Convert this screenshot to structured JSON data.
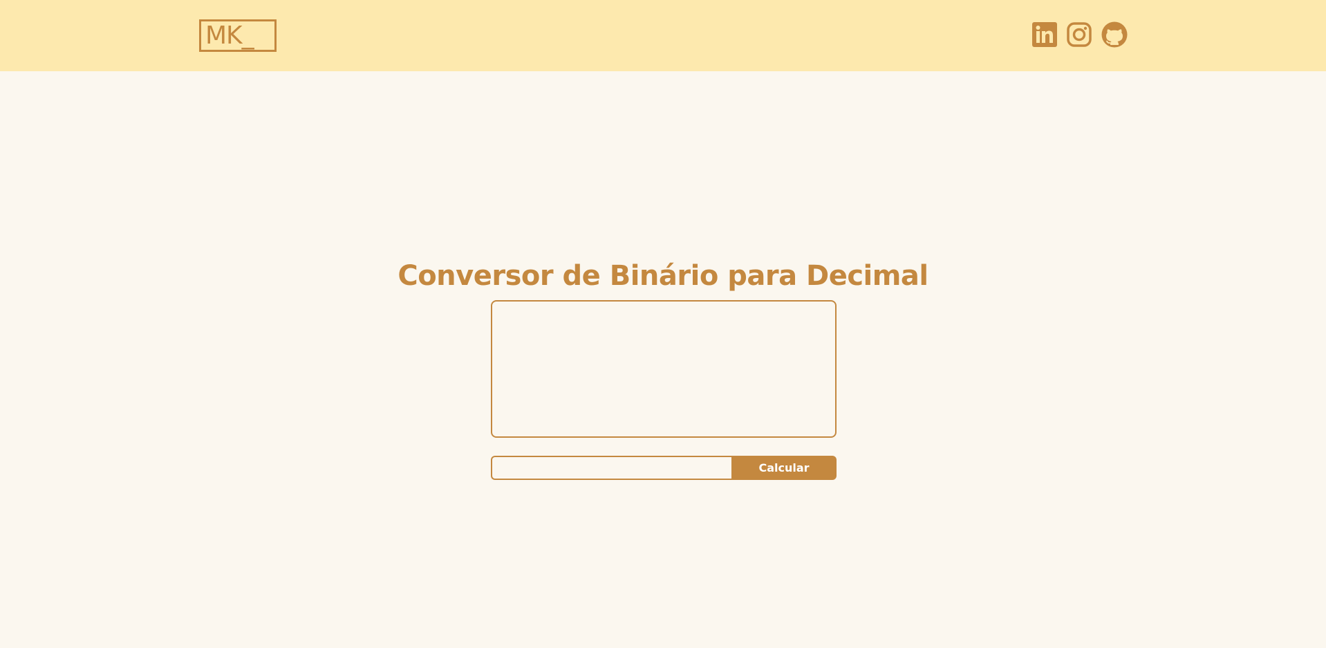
{
  "header": {
    "logo_text": "MK_",
    "social_links": [
      {
        "name": "LinkedIn",
        "icon": "linkedin-icon"
      },
      {
        "name": "Instagram",
        "icon": "instagram-icon"
      },
      {
        "name": "GitHub",
        "icon": "github-icon"
      }
    ]
  },
  "main": {
    "title": "Conversor de Binário para Decimal",
    "binary_input": {
      "value": "",
      "placeholder": ""
    },
    "result": {
      "value": "",
      "placeholder": ""
    },
    "calculate_label": "Calcular"
  },
  "colors": {
    "header_bg": "#fde9ae",
    "page_bg": "#fbf7ef",
    "accent": "#c4883f"
  }
}
